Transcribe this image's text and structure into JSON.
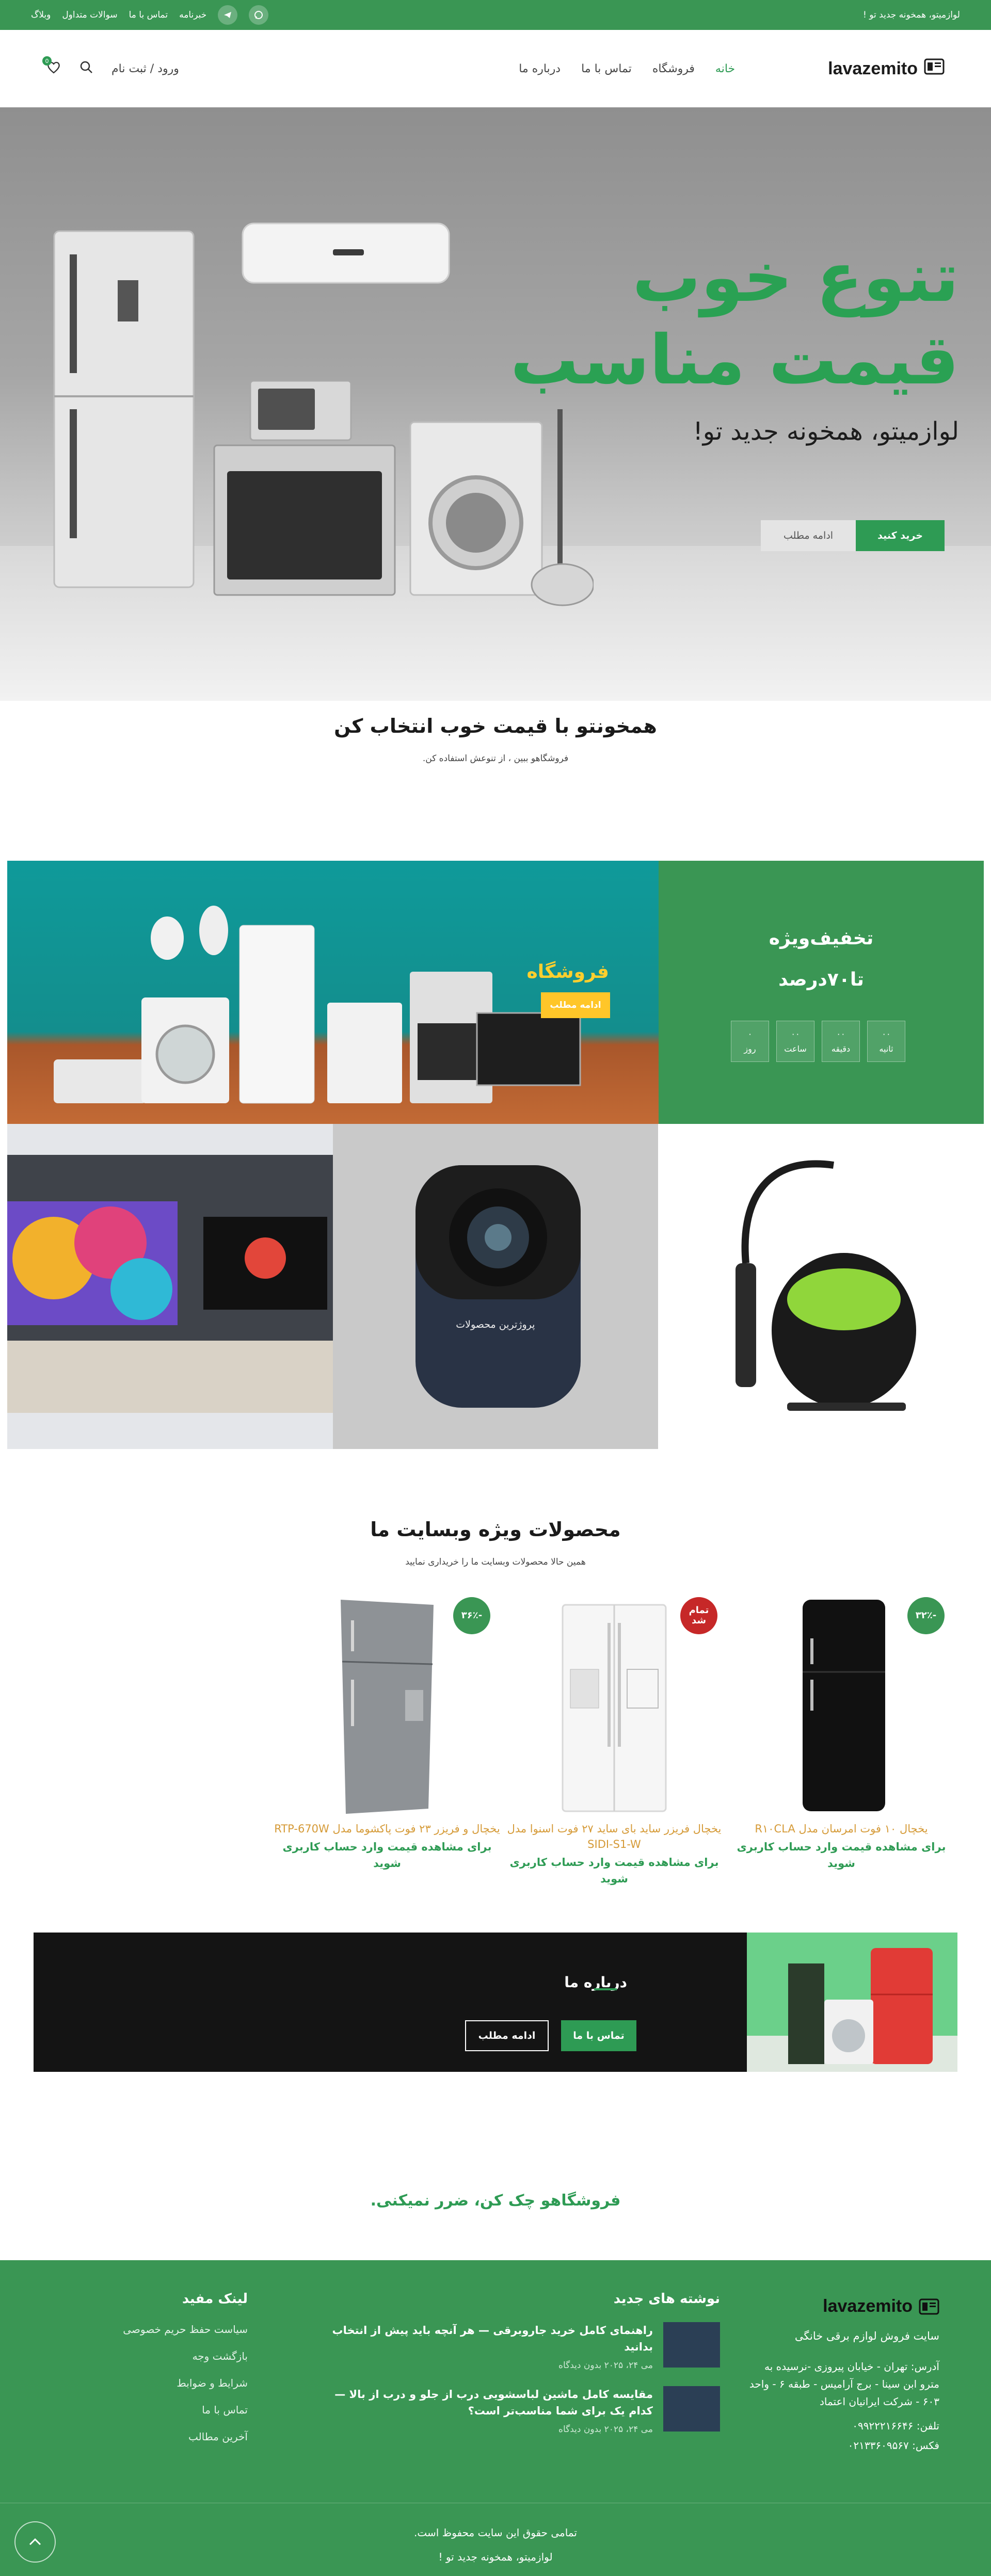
{
  "topbar": {
    "tagline": "لوازمیتو، همخونه جدید تو !",
    "links": [
      "خبرنامه",
      "تماس با ما",
      "سوالات متداول",
      "وبلاگ"
    ]
  },
  "header": {
    "logo": "lavazemito",
    "nav": [
      "خانه",
      "فروشگاه",
      "تماس با ما",
      "درباره ما"
    ],
    "login": "ورود / ثبت نام",
    "cart_count": "0"
  },
  "hero": {
    "title_line1": "تنوع خوب",
    "title_line2": "قیمت مناسب",
    "subtitle": "لوازمیتو، همخونه جدید تو!",
    "buy_button": "خرید کنید",
    "more_button": "ادامه مطلب"
  },
  "intro": {
    "title": "همخونتو با قیمت خوب انتخاب کن",
    "subtitle": "فروشگاهو ببین ، از تنوعش استفاده کن."
  },
  "promo": {
    "shop_label": "فروشگاه",
    "shop_button": "ادامه مطلب",
    "discount_title": "تخفیف‌ویژه",
    "discount_value": "تا۷۰درصد",
    "timer": [
      {
        "value": "۰۰",
        "label": "ثانیه"
      },
      {
        "value": "۰۰",
        "label": "دقیقه"
      },
      {
        "value": "۰۰",
        "label": "ساعت"
      },
      {
        "value": "۰",
        "label": "روز"
      }
    ],
    "projector_label": "پرو‌ژترین محصولات"
  },
  "products_section": {
    "title": "محصولات ویژه وبسایت ما",
    "subtitle": "همین حالا محصولات وبسایت ما را خریداری نمایید",
    "items": [
      {
        "name": "یخچال ۱۰ فوت امرسان مدل R۱۰CLA",
        "price": "برای مشاهده قیمت وارد حساب کاربری شوید",
        "badge": "-۳۲٪",
        "badge_color": "#3a9654"
      },
      {
        "name": "یخچال فریزر ساید بای ساید ۲۷ فوت اسنوا مدل SIDI-S1-W",
        "price": "برای مشاهده قیمت وارد حساب کاربری شوید",
        "badge": "تمام شد",
        "badge_color": "#c62828"
      },
      {
        "name": "یخچال و فریزر ۲۳ فوت پاکشوما مدل RTP-670W",
        "price": "برای مشاهده قیمت وارد حساب کاربری شوید",
        "badge": "-۳۶٪",
        "badge_color": "#3a9654"
      }
    ]
  },
  "about": {
    "title": "درباره ما",
    "contact_button": "تماس با ما",
    "more_button": "ادامه مطلب"
  },
  "slogan": "فروشگاهو چک کن، ضرر نمیکنی.",
  "footer": {
    "logo": "lavazemito",
    "about_text": "سایت فروش لوازم برقی خانگی",
    "address": "آدرس: تهران - خیابان پیروزی -نرسیده به مترو ابن سینا - برج آرامیس - طبقه ۶ - واحد ۶۰۳ - شرکت ایرانیان اعتماد",
    "phone": "تلفن: ۰۹۹۲۲۲۱۶۶۴۶",
    "fax": "فکس: ۰۲۱۳۳۶۰۹۵۶۷",
    "posts_title": "نوشته های جدید",
    "posts": [
      {
        "title": "راهنمای کامل خرید جاروبرقی — هر آنچه باید پیش از انتخاب بدانید",
        "date": "می ۲۴، ۲۰۲۵",
        "comments": "بدون دیدگاه"
      },
      {
        "title": "مقایسه کامل ماشین لباسشویی درب از جلو و درب از بالا — کدام یک برای شما مناسب‌تر است؟",
        "date": "می ۲۴، ۲۰۲۵",
        "comments": "بدون دیدگاه"
      }
    ],
    "links_title": "لینک مفید",
    "links": [
      "سیاست حفظ حریم خصوصی",
      "بازگشت وجه",
      "شرایط و ضوابط",
      "تماس با ما",
      "آخرین مطالب"
    ],
    "copyright": "تمامی حقوق این سایت محفوظ است.",
    "tagline": "لوازمیتو، همخونه جدید تو !"
  }
}
